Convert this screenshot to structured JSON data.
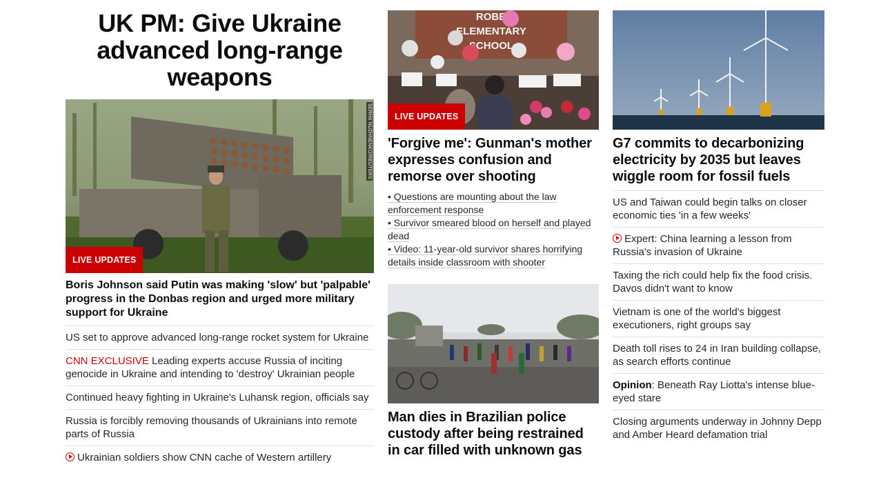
{
  "colors": {
    "accent": "#cc0000",
    "text": "#0c0c0c",
    "divider": "#e0e0e0"
  },
  "col1": {
    "headline": "UK PM: Give Ukraine advanced long-range weapons",
    "image_credit": "SERHII NUZHNENKO/REUTERS",
    "badge": "LIVE UPDATES",
    "lead": "Boris Johnson said Putin was making 'slow' but 'palpable' progress in the Donbas region and urged more military support for Ukraine",
    "items": [
      {
        "label": "",
        "text": "US set to approve advanced long-range rocket system for Ukraine"
      },
      {
        "label": "CNN EXCLUSIVE",
        "text": " Leading experts accuse Russia of inciting genocide in Ukraine and intending to 'destroy' Ukrainian people"
      },
      {
        "label": "",
        "text": "Continued heavy fighting in Ukraine's Luhansk region, officials say"
      },
      {
        "label": "",
        "text": "Russia is forcibly removing thousands of Ukrainians into remote parts of Russia"
      },
      {
        "label": "",
        "text": "Ukrainian soldiers show CNN cache of Western artillery",
        "icon": "play-icon"
      }
    ]
  },
  "col2": {
    "story1": {
      "badge": "LIVE UPDATES",
      "headline": "'Forgive me': Gunman's mother expresses confusion and remorse over shooting",
      "bullets": [
        "• Questions are mounting about the law enforcement response",
        "• Survivor smeared blood on herself and played dead",
        "• Video: 11-year-old survivor shares horrifying details inside classroom with shooter"
      ],
      "sign_text": "ROBB ELEMENTARY SCHOOL"
    },
    "story2": {
      "headline": "Man dies in Brazilian police custody after being restrained in car filled with unknown gas"
    }
  },
  "col3": {
    "headline": "G7 commits to decarbonizing electricity by 2035 but leaves wiggle room for fossil fuels",
    "items": [
      {
        "prefix": "",
        "text": "US and Taiwan could begin talks on closer economic ties 'in a few weeks'"
      },
      {
        "prefix": "",
        "text": "Expert: China learning a lesson from Russia's invasion of Ukraine",
        "icon": "play-icon"
      },
      {
        "prefix": "",
        "text": "Taxing the rich could help fix the food crisis. Davos didn't want to know"
      },
      {
        "prefix": "",
        "text": "Vietnam is one of the world's biggest executioners, right groups say"
      },
      {
        "prefix": "",
        "text": "Death toll rises to 24 in Iran building collapse, as search efforts continue"
      },
      {
        "prefix": "Opinion",
        "text": ": Beneath Ray Liotta's intense blue-eyed stare"
      },
      {
        "prefix": "",
        "text": "Closing arguments underway in Johnny Depp and Amber Heard defamation trial"
      }
    ]
  }
}
